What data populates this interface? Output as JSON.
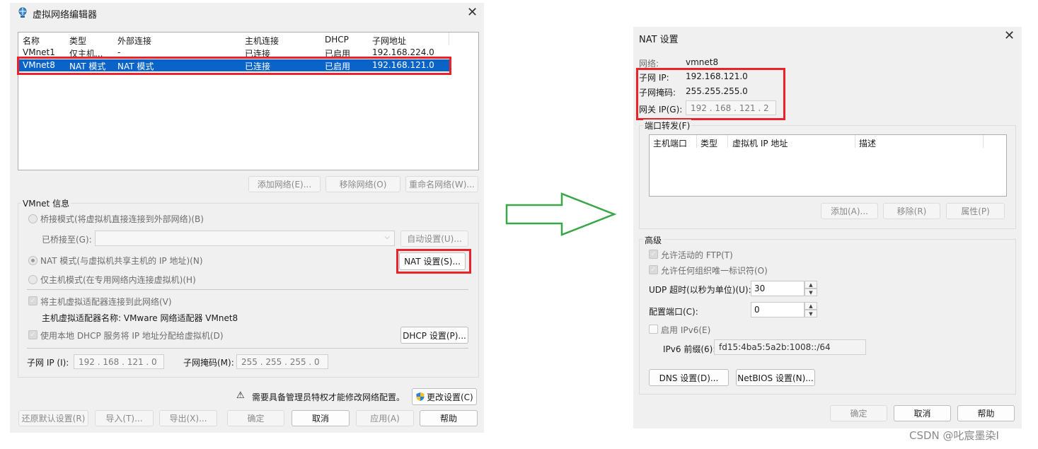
{
  "left": {
    "title": "虚拟网络编辑器",
    "table": {
      "headers": [
        "名称",
        "类型",
        "外部连接",
        "主机连接",
        "DHCP",
        "子网地址"
      ],
      "rows": [
        [
          "VMnet1",
          "仅主机...",
          "-",
          "已连接",
          "已启用",
          "192.168.224.0"
        ],
        [
          "VMnet8",
          "NAT 模式",
          "NAT 模式",
          "已连接",
          "已启用",
          "192.168.121.0"
        ]
      ]
    },
    "list_buttons": {
      "add": "添加网络(E)...",
      "remove": "移除网络(O)",
      "rename": "重命名网络(W)..."
    },
    "vmnet_info": {
      "label": "VMnet 信息",
      "bridge": "桥接模式(将虚拟机直接连接到外部网络)(B)",
      "bridged_to": "已桥接至(G):",
      "auto_settings": "自动设置(U)...",
      "nat": "NAT 模式(与虚拟机共享主机的 IP 地址)(N)",
      "nat_settings": "NAT 设置(S)...",
      "host_only": "仅主机模式(在专用网络内连接虚拟机)(H)",
      "connect_adapter": "将主机虚拟适配器连接到此网络(V)",
      "adapter_name": "主机虚拟适配器名称: VMware 网络适配器 VMnet8",
      "dhcp": "使用本地 DHCP 服务将 IP 地址分配给虚拟机(D)",
      "dhcp_settings": "DHCP 设置(P)...",
      "subnet_ip_label": "子网 IP (I):",
      "subnet_ip": "192 . 168 . 121 .  0",
      "subnet_mask_label": "子网掩码(M):",
      "subnet_mask": "255 . 255 . 255 .  0"
    },
    "admin_notice": "需要具备管理员特权才能修改网络配置。",
    "change_settings": "更改设置(C)",
    "bottom_buttons": {
      "restore": "还原默认设置(R)",
      "import": "导入(T)...",
      "export": "导出(X)...",
      "ok": "确定",
      "cancel": "取消",
      "apply": "应用(A)",
      "help": "帮助"
    }
  },
  "right": {
    "title": "NAT 设置",
    "network_label": "网络:",
    "network_value": "vmnet8",
    "subnet_ip_label": "子网 IP:",
    "subnet_ip_value": "192.168.121.0",
    "subnet_mask_label": "子网掩码:",
    "subnet_mask_value": "255.255.255.0",
    "gateway_label": "网关 IP(G):",
    "gateway_value": "192 . 168 . 121 .  2",
    "port_forward": {
      "label": "端口转发(F)",
      "headers": [
        "主机端口",
        "类型",
        "虚拟机 IP 地址",
        "描述"
      ],
      "add": "添加(A)...",
      "remove": "移除(R)",
      "properties": "属性(P)"
    },
    "advanced": {
      "label": "高级",
      "allow_ftp": "允许活动的 FTP(T)",
      "allow_oui": "允许任何组织唯一标识符(O)",
      "udp_timeout_label": "UDP 超时(以秒为单位)(U):",
      "udp_timeout": "30",
      "config_port_label": "配置端口(C):",
      "config_port": "0",
      "enable_ipv6": "启用 IPv6(E)",
      "ipv6_prefix_label": "IPv6 前缀(6):",
      "ipv6_prefix": "fd15:4ba5:5a2b:1008::/64",
      "dns": "DNS 设置(D)...",
      "netbios": "NetBIOS 设置(N)..."
    },
    "bottom_buttons": {
      "ok": "确定",
      "cancel": "取消",
      "help": "帮助"
    }
  },
  "watermark": "CSDN @叱宸墨染I",
  "colors": {
    "selection": "#0a64c8",
    "highlight_box": "#e8232c",
    "arrow": "#3aa64a"
  }
}
